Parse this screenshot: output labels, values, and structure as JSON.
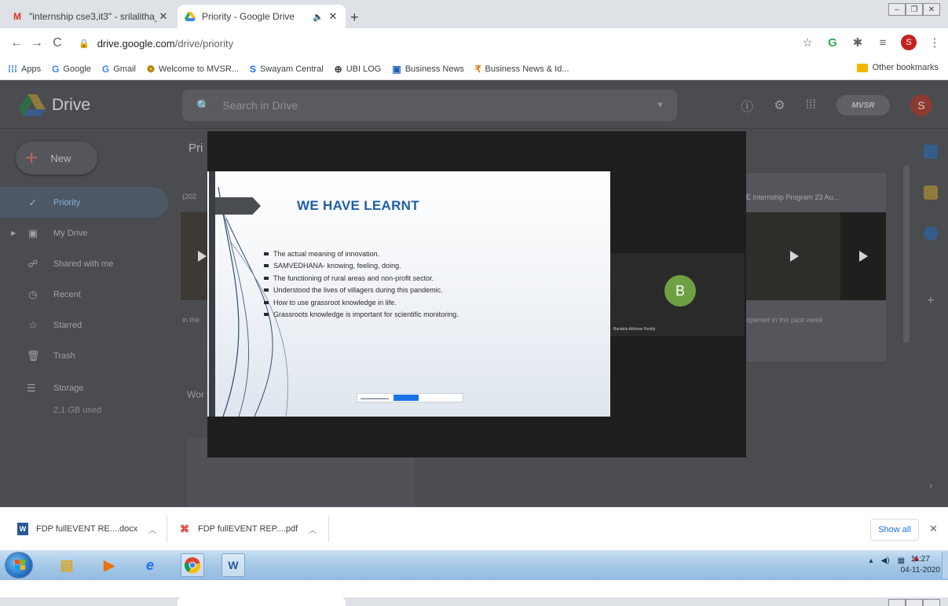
{
  "browser": {
    "tabs": [
      {
        "title": "\"internship cse3,it3\" - srilalitha_s",
        "favicon": "gmail-icon",
        "active": false
      },
      {
        "title": "Priority - Google Drive",
        "favicon": "google-drive-icon",
        "active": true,
        "audio": true
      }
    ],
    "url_host": "drive.google.com",
    "url_path": "/drive/priority",
    "bookmarks": [
      {
        "label": "Apps",
        "icon": "apps-grid-icon"
      },
      {
        "label": "Google",
        "icon": "google-icon"
      },
      {
        "label": "Gmail",
        "icon": "google-icon"
      },
      {
        "label": "Welcome to MVSR...",
        "icon": "mvsr-icon"
      },
      {
        "label": "Swayam Central",
        "icon": "swayam-icon"
      },
      {
        "label": "UBI LOG",
        "icon": "globe-icon"
      },
      {
        "label": "Business News",
        "icon": "news-icon"
      },
      {
        "label": "Business News & Id...",
        "icon": "rupee-icon"
      }
    ],
    "other_bookmarks": "Other bookmarks",
    "profile_initial": "S"
  },
  "drive": {
    "title": "Drive",
    "search_placeholder": "Search in Drive",
    "account_badge": "MVSR",
    "avatar_initial": "S",
    "new_label": "New",
    "nav": [
      {
        "label": "Priority",
        "icon": "priority-icon",
        "selected": true
      },
      {
        "label": "My Drive",
        "icon": "my-drive-icon",
        "selected": false
      },
      {
        "label": "Shared with me",
        "icon": "people-icon",
        "selected": false
      },
      {
        "label": "Recent",
        "icon": "clock-icon",
        "selected": false
      },
      {
        "label": "Starred",
        "icon": "star-icon",
        "selected": false
      },
      {
        "label": "Trash",
        "icon": "trash-icon",
        "selected": false
      }
    ],
    "storage_label": "Storage",
    "storage_used": "2.1 GB used",
    "heading_fragment": "Pri",
    "section_fragment": "Wor",
    "date_fragment": "(202",
    "card_left_text": "in the",
    "card_right_title": "E Internship Program 23 Au...",
    "card_right_text": "opened in the past week"
  },
  "video": {
    "slide_title": "WE HAVE LEARNT",
    "bullets": [
      "The actual meaning of innovation.",
      "SAMVEDHANA- knowing, feeling, doing.",
      "The functioning of rural areas and non-profit sector.",
      "Understood the lives of villagers during this pandemic.",
      "How to use grassroot knowledge in life.",
      "Grassroots knowledge is important for scientific monitoring."
    ],
    "participant_initial": "B",
    "participant_name": "Bandela Abhinav Reddy",
    "participant_color": "#6fa044"
  },
  "downloads": {
    "items": [
      {
        "name": "FDP fullEVENT RE....docx",
        "icon": "word-doc-icon"
      },
      {
        "name": "FDP fullEVENT REP....pdf",
        "icon": "pdf-icon"
      }
    ],
    "show_all": "Show all"
  },
  "taskbar": {
    "time": "11:27",
    "date": "04-11-2020"
  },
  "colors": {
    "drive_selected": "#8ab0dd",
    "slide_title": "#1f5ea8",
    "link_blue": "#1a73e8"
  }
}
